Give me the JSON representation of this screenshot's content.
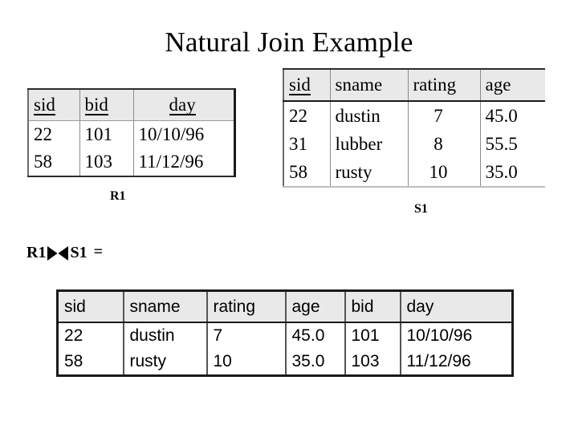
{
  "slide": {
    "title": "Natural Join Example",
    "background_color": "#ffffff",
    "text_color": "#000000",
    "header_fill": "#e9e9e9"
  },
  "tables": {
    "r1": {
      "name": "R1",
      "caption": "R1",
      "columns": [
        "sid",
        "bid",
        "day"
      ],
      "key_columns": [
        "sid",
        "bid",
        "day"
      ],
      "rows": [
        [
          "22",
          "101",
          "10/10/96"
        ],
        [
          "58",
          "103",
          "11/12/96"
        ]
      ]
    },
    "s1": {
      "name": "S1",
      "caption": "S1",
      "columns": [
        "sid",
        "sname",
        "rating",
        "age"
      ],
      "key_columns": [
        "sid"
      ],
      "rows": [
        [
          "22",
          "dustin",
          "7",
          "45.0"
        ],
        [
          "31",
          "lubber",
          "8",
          "55.5"
        ],
        [
          "58",
          "rusty",
          "10",
          "35.0"
        ]
      ]
    },
    "result": {
      "name": "R1 join S1",
      "columns": [
        "sid",
        "sname",
        "rating",
        "age",
        "bid",
        "day"
      ],
      "rows": [
        [
          "22",
          "dustin",
          "7",
          "45.0",
          "101",
          "10/10/96"
        ],
        [
          "58",
          "rusty",
          "10",
          "35.0",
          "103",
          "11/12/96"
        ]
      ]
    }
  },
  "expression": {
    "left_operand": "R1",
    "operator_symbol": "⋈",
    "operator_name": "natural-join-bowtie",
    "right_operand": "S1",
    "equals": "="
  }
}
